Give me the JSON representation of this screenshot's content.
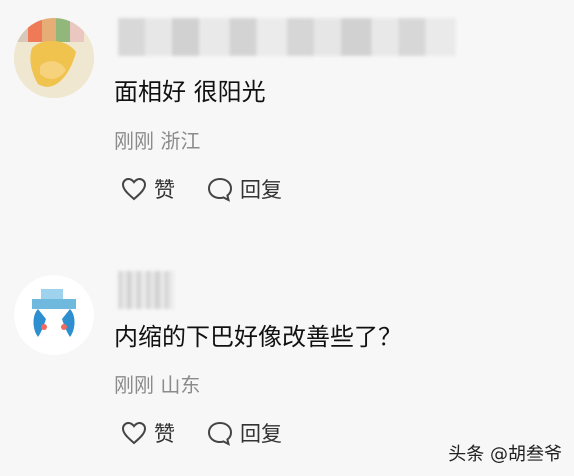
{
  "comments": [
    {
      "text": "面相好 很阳光",
      "meta": "刚刚 浙江",
      "like_label": "赞",
      "reply_label": "回复",
      "avatar_icon": "blurred-photo-avatar-icon"
    },
    {
      "text": "内缩的下巴好像改善些了？",
      "meta": "刚刚 山东",
      "like_label": "赞",
      "reply_label": "回复",
      "avatar_icon": "cartoon-avatar-icon"
    }
  ],
  "watermark": "头条 @胡叁爷",
  "colors": {
    "background": "#f7f7f7",
    "meta": "#8b8b8b",
    "text": "#111111"
  }
}
